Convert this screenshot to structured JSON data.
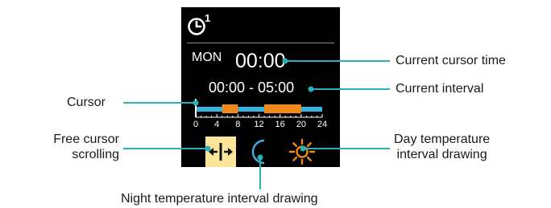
{
  "screen": {
    "program_number": "1",
    "day": "MON",
    "cursor_time": "00:00",
    "interval": "00:00 - 05:00",
    "timeline": {
      "hour_range": [
        0,
        24
      ],
      "tick_labels": [
        "0",
        "4",
        "8",
        "12",
        "16",
        "20",
        "24"
      ],
      "cursor_hour": 0,
      "day_intervals": [
        [
          5,
          8
        ],
        [
          13,
          20
        ]
      ],
      "colors": {
        "night_bar": "#3ab3e0",
        "day_bar": "#f08a1c"
      }
    },
    "icons": {
      "free_cursor": "left-right-arrow-icon",
      "night": "moon-icon",
      "day": "sun-icon"
    },
    "colors": {
      "cursor_icon_bg": "#fde59a",
      "moon": "#3ab3e0",
      "sun": "#f08a1c"
    }
  },
  "callouts": {
    "cursor_time": "Current cursor time",
    "interval": "Current interval",
    "cursor": "Cursor",
    "free_cursor_line1": "Free cursor",
    "free_cursor_line2": "scrolling",
    "day_drawing_line1": "Day temperature",
    "day_drawing_line2": "interval drawing",
    "night_drawing": "Night temperature interval drawing"
  },
  "leader_color": "#2ab0b8"
}
